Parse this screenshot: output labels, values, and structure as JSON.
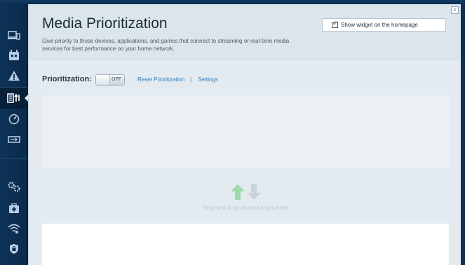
{
  "header": {
    "title": "Media Prioritization",
    "description": "Give priority to those devices, applications, and games that connect to streaming or real-time media services for best performance on your home network.",
    "close_label": "×",
    "widget_checkbox_label": "Show widget on the homepage",
    "widget_checked": true
  },
  "prioritization": {
    "label": "Prioritization:",
    "switch_state": "OFF",
    "reset_link": "Reset Prioritization",
    "separator": "|",
    "settings_link": "Settings"
  },
  "drop_zone": {
    "hint_text": "Drag and drop devices to prioritize"
  },
  "sidebar": {
    "items": [
      {
        "icon": "devices-icon"
      },
      {
        "icon": "parental-controls-icon"
      },
      {
        "icon": "alert-icon"
      },
      {
        "icon": "media-prioritization-icon",
        "active": true
      },
      {
        "icon": "speed-test-icon"
      },
      {
        "icon": "external-storage-icon"
      },
      {
        "icon": "connectivity-settings-icon"
      },
      {
        "icon": "troubleshooting-icon"
      },
      {
        "icon": "wifi-settings-icon"
      },
      {
        "icon": "security-icon"
      }
    ]
  },
  "colors": {
    "sidebar_bg": "#0c2f52",
    "panel_bg": "#e4ebf0",
    "link": "#2b7bbd",
    "arrow_green": "#9fd9a8"
  }
}
